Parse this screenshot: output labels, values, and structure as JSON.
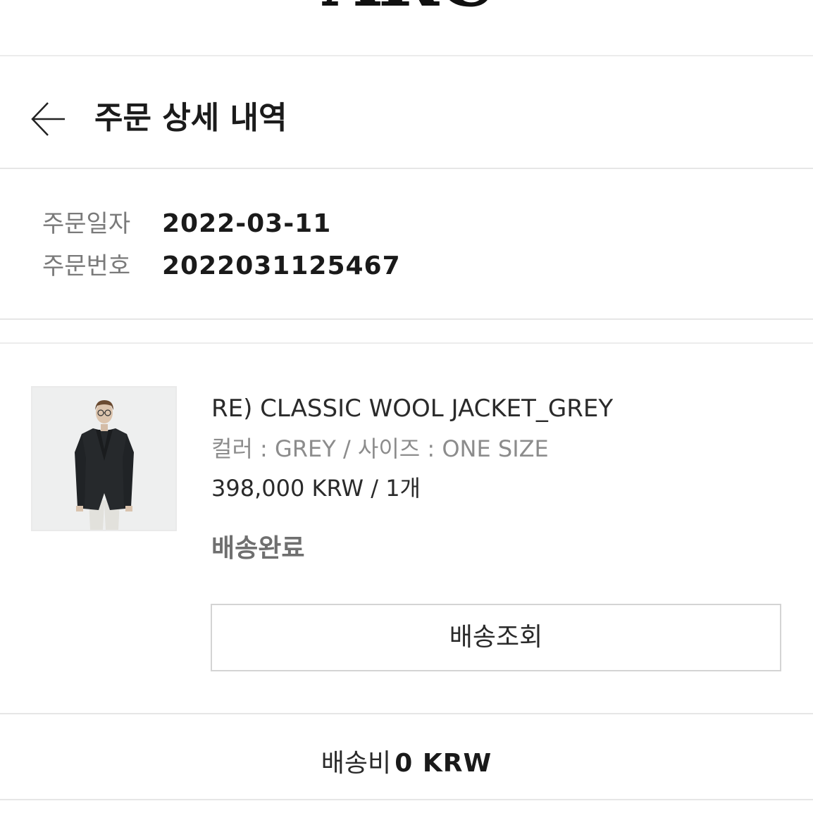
{
  "brand": {
    "logo_text": "ARC"
  },
  "header": {
    "back_icon": "arrow-left-icon",
    "title": "주문 상세 내역"
  },
  "order": {
    "date_label": "주문일자",
    "date_value": "2022-03-11",
    "number_label": "주문번호",
    "number_value": "2022031125467"
  },
  "product": {
    "image_alt": "Person wearing grey wool jacket",
    "name": "RE) CLASSIC WOOL JACKET_GREY",
    "option": "컬러 : GREY / 사이즈 : ONE SIZE",
    "price": "398,000 KRW / 1개",
    "status": "배송완료",
    "track_button": "배송조회"
  },
  "shipping": {
    "label": "배송비",
    "value": "0 KRW"
  },
  "colors": {
    "divider": "#e6e6e6",
    "label_grey": "#7a7a7a",
    "status_grey": "#6f6f6f",
    "text": "#222222"
  }
}
